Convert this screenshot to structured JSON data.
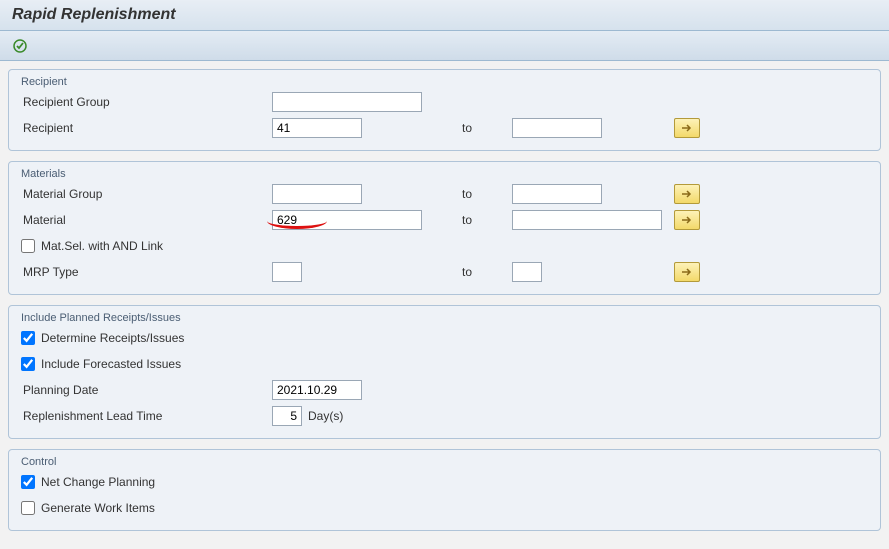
{
  "title": "Rapid Replenishment",
  "groups": {
    "recipient": {
      "legend": "Recipient",
      "recipient_group_label": "Recipient Group",
      "recipient_group_value": "",
      "recipient_label": "Recipient",
      "recipient_from": "41",
      "recipient_to": "",
      "to_label": "to"
    },
    "materials": {
      "legend": "Materials",
      "material_group_label": "Material Group",
      "material_group_from": "",
      "material_group_to": "",
      "material_label": "Material",
      "material_from": "629",
      "material_to": "",
      "matsel_label": "Mat.Sel. with AND Link",
      "matsel_checked": false,
      "mrp_type_label": "MRP Type",
      "mrp_type_from": "",
      "mrp_type_to": "",
      "to_label": "to"
    },
    "planned": {
      "legend": "Include Planned Receipts/Issues",
      "determine_label": "Determine Receipts/Issues",
      "determine_checked": true,
      "forecast_label": "Include Forecasted Issues",
      "forecast_checked": true,
      "planning_date_label": "Planning Date",
      "planning_date_value": "2021.10.29",
      "lead_time_label": "Replenishment Lead Time",
      "lead_time_value": "5",
      "days_label": "Day(s)"
    },
    "control": {
      "legend": "Control",
      "net_change_label": "Net Change Planning",
      "net_change_checked": true,
      "workitems_label": "Generate Work Items",
      "workitems_checked": false
    }
  }
}
